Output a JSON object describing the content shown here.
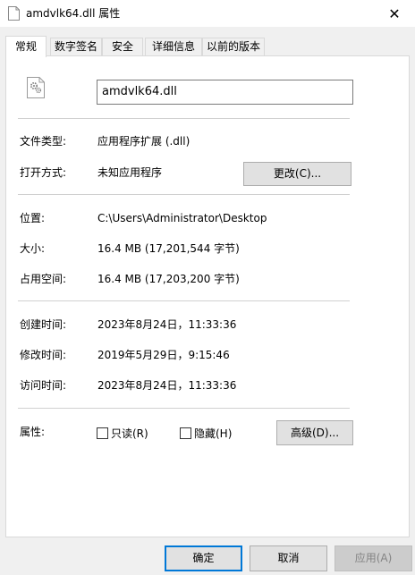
{
  "window": {
    "title": "amdvlk64.dll 属性",
    "close_glyph": "✕"
  },
  "tabs": [
    {
      "label": "常规",
      "active": true
    },
    {
      "label": "数字签名"
    },
    {
      "label": "安全"
    },
    {
      "label": "详细信息"
    },
    {
      "label": "以前的版本"
    }
  ],
  "general": {
    "file_name": "amdvlk64.dll",
    "file_type_label": "文件类型:",
    "file_type_value": "应用程序扩展 (.dll)",
    "open_with_label": "打开方式:",
    "open_with_value": "未知应用程序",
    "change_button": "更改(C)...",
    "location_label": "位置:",
    "location_value": "C:\\Users\\Administrator\\Desktop",
    "size_label": "大小:",
    "size_value": "16.4 MB (17,201,544 字节)",
    "size_on_disk_label": "占用空间:",
    "size_on_disk_value": "16.4 MB (17,203,200 字节)",
    "created_label": "创建时间:",
    "created_value": "2023年8月24日，11:33:36",
    "modified_label": "修改时间:",
    "modified_value": "2019年5月29日，9:15:46",
    "accessed_label": "访问时间:",
    "accessed_value": "2023年8月24日，11:33:36",
    "attributes_label": "属性:",
    "readonly_label": "只读(R)",
    "readonly_checked": false,
    "hidden_label": "隐藏(H)",
    "hidden_checked": false,
    "advanced_button": "高级(D)..."
  },
  "footer": {
    "ok_button": "确定",
    "cancel_button": "取消",
    "apply_button": "应用(A)"
  }
}
